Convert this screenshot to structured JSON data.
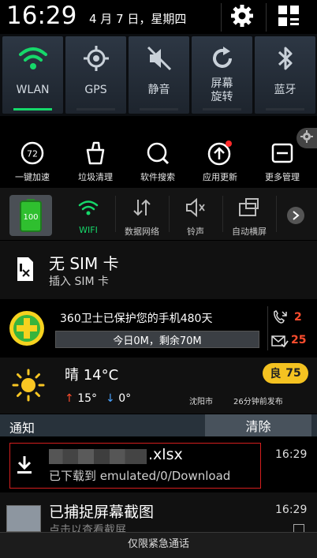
{
  "status": {
    "time": "16:29",
    "date": "4 月 7 日，星期四"
  },
  "header_icons": [
    "gear-icon",
    "grid-icon"
  ],
  "quick_toggles": [
    {
      "label": "WLAN",
      "icon": "wifi-icon",
      "active": true
    },
    {
      "label": "GPS",
      "icon": "gps-icon",
      "active": false
    },
    {
      "label": "静音",
      "icon": "mute-icon",
      "active": false
    },
    {
      "label": "屏幕\n旋转",
      "icon": "rotate-icon",
      "active": false
    },
    {
      "label": "蓝牙",
      "icon": "bluetooth-icon",
      "active": false
    }
  ],
  "tools": [
    {
      "label": "一键加速",
      "icon": "speed-icon",
      "value": "72"
    },
    {
      "label": "垃圾清理",
      "icon": "trash-icon"
    },
    {
      "label": "软件搜索",
      "icon": "search-icon"
    },
    {
      "label": "应用更新",
      "icon": "update-icon"
    },
    {
      "label": "更多管理",
      "icon": "more-icon"
    }
  ],
  "quick_row2": {
    "battery": "100",
    "items": [
      {
        "label": "WIFI",
        "icon": "wifi-icon",
        "active": true
      },
      {
        "label": "数据网络",
        "icon": "data-icon",
        "active": false
      },
      {
        "label": "铃声",
        "icon": "ring-icon",
        "active": false
      },
      {
        "label": "自动横屏",
        "icon": "rotate-icon",
        "active": false
      }
    ]
  },
  "sim": {
    "title": "无 SIM 卡",
    "subtitle": "插入 SIM 卡"
  },
  "security": {
    "title": "360卫士已保护您的手机480天",
    "status": "今日0M，剩余70M",
    "calls": "2",
    "messages": "25"
  },
  "weather": {
    "condition": "晴 14°C",
    "high": "15°",
    "low": "0°",
    "aqi_label": "良",
    "aqi_value": "75",
    "city": "沈阳市",
    "published": "26分钟前发布"
  },
  "notifications": {
    "header": "通知",
    "clear_label": "清除",
    "items": [
      {
        "title": ".xlsx",
        "subtitle": "已下载到 emulated/0/Download",
        "time": "16:29"
      },
      {
        "title": "已捕捉屏幕截图",
        "subtitle": "点击以查看截屏",
        "time": "16:29"
      }
    ]
  },
  "bottom": {
    "emergency": "仅限紧急通话"
  },
  "colors": {
    "accent_green": "#16d86a",
    "alert_red": "#ff4d2e",
    "aqi_yellow": "#f4c221",
    "highlight_red": "#d41e1e"
  }
}
